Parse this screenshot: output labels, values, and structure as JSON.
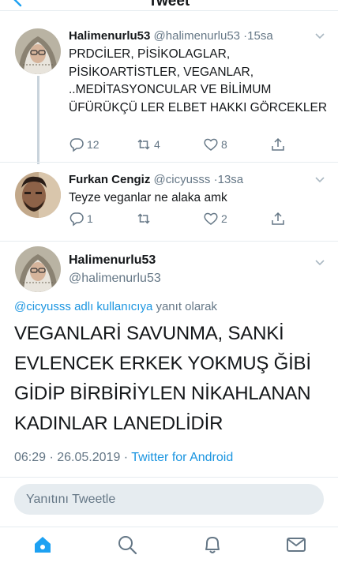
{
  "header": {
    "title": "Tweet"
  },
  "thread": [
    {
      "name": "Halimenurlu53",
      "handle": "@halimenurlu53",
      "separator": "·",
      "time": "15sa",
      "text": "PRDCİLER, PİSİKOLAGLAR, PİSİKOARTİSTLER, VEGANLAR, ..MEDİTASYONCULAR VE BİLİMUM ÜFÜRÜKÇÜ LER ELBET HAKKI GÖRCEKLER",
      "replies": "12",
      "retweets": "4",
      "likes": "8"
    },
    {
      "name": "Furkan Cengiz",
      "handle": "@cicyusss",
      "separator": "·",
      "time": "13sa",
      "text": "Teyze veganlar ne alaka amk",
      "replies": "1",
      "retweets": "",
      "likes": "2"
    }
  ],
  "main": {
    "name": "Halimenurlu53",
    "handle": "@halimenurlu53",
    "reply_link": "@cicyusss adlı kullanıcıya",
    "reply_suffix": " yanıt olarak",
    "text": "VEGANLARİ  SAVUNMA, SANKİ EVLENCEK ERKEK YOKMUŞ ĞİBİ GİDİP BİRBİRİYLEN NİKAHLANAN KADINLAR LANEDLİDİR",
    "datetime": "06:29 · 26.05.2019 · ",
    "source": "Twitter for Android"
  },
  "reply": {
    "placeholder": "Yanıtını Tweetle"
  },
  "colors": {
    "accent": "#1b95e0",
    "secondary_text": "#657786",
    "divider": "#e6ecf0"
  },
  "tabs": [
    "home-icon",
    "search-icon",
    "notifications-icon",
    "messages-icon"
  ]
}
